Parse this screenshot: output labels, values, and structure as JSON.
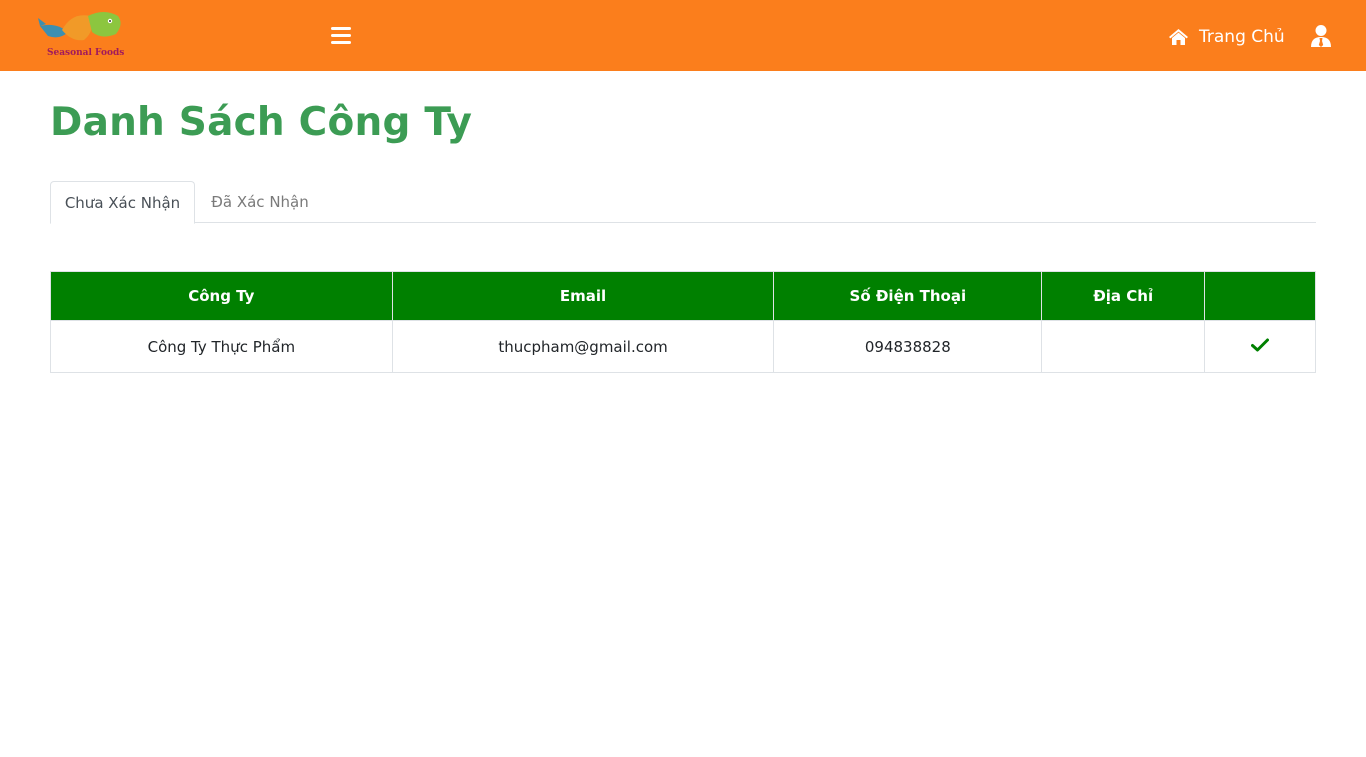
{
  "header": {
    "brand_text": "Seasonal Foods",
    "home_label": "Trang Chủ",
    "icons": {
      "menu": "hamburger-menu-icon",
      "home": "home-icon",
      "user": "user-icon"
    }
  },
  "page": {
    "title": "Danh Sách Công Ty"
  },
  "tabs": [
    {
      "label": "Chưa Xác Nhận",
      "active": true
    },
    {
      "label": "Đã Xác Nhận",
      "active": false
    }
  ],
  "table": {
    "columns": [
      "Công Ty",
      "Email",
      "Số Điện Thoại",
      "Địa Chỉ",
      ""
    ],
    "rows": [
      {
        "company": "Công Ty Thực Phẩm",
        "email": "thucpham@gmail.com",
        "phone": "094838828",
        "address": "",
        "action_icon": "check-icon"
      }
    ]
  },
  "colors": {
    "navbar": "#fb7e1c",
    "title": "#3c9c54",
    "table_header": "#008000",
    "check": "#008000"
  }
}
